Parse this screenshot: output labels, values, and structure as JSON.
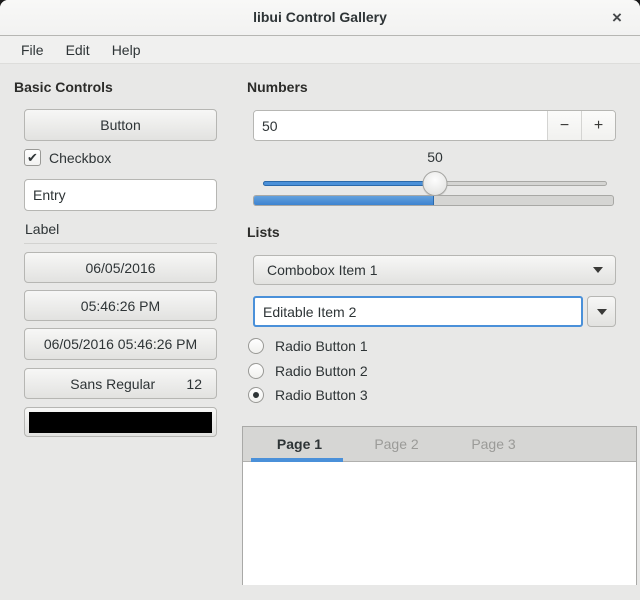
{
  "window": {
    "title": "libui Control Gallery"
  },
  "icons": {
    "close": "×",
    "check": "✔",
    "minus": "−",
    "plus": "+"
  },
  "menu": {
    "items": [
      "File",
      "Edit",
      "Help"
    ]
  },
  "basic_controls": {
    "heading": "Basic Controls",
    "button_label": "Button",
    "checkbox_label": "Checkbox",
    "checkbox_checked": true,
    "entry_value": "Entry",
    "label_text": "Label",
    "date_button": "06/05/2016",
    "time_button": "05:46:26 PM",
    "datetime_button": "06/05/2016 05:46:26 PM",
    "font_button": {
      "name": "Sans Regular",
      "size": "12"
    },
    "color_button": {
      "color": "#000000",
      "swatch_style": "background:#000000"
    }
  },
  "numbers": {
    "heading": "Numbers",
    "spinbutton": {
      "value": "50"
    },
    "slider": {
      "value": "50",
      "percent": 50,
      "fill_style": "width:50%",
      "thumb_style": "left:50%",
      "label_style": "left:435px; top:149px"
    },
    "progress": {
      "percent": 50,
      "fill_style": "width:50%"
    }
  },
  "lists": {
    "heading": "Lists",
    "combobox_value": "Combobox Item 1",
    "editable_combobox_value": "Editable Item 2",
    "radios": [
      {
        "label": "Radio Button 1",
        "selected": false
      },
      {
        "label": "Radio Button 2",
        "selected": false
      },
      {
        "label": "Radio Button 3",
        "selected": true
      }
    ],
    "tabs": [
      {
        "label": "Page 1",
        "active": true
      },
      {
        "label": "Page 2",
        "active": false
      },
      {
        "label": "Page 3",
        "active": false
      }
    ]
  },
  "colors": {
    "accent": "#4a90d9",
    "window_bg": "#e8e8e7",
    "text": "#2e3436"
  }
}
